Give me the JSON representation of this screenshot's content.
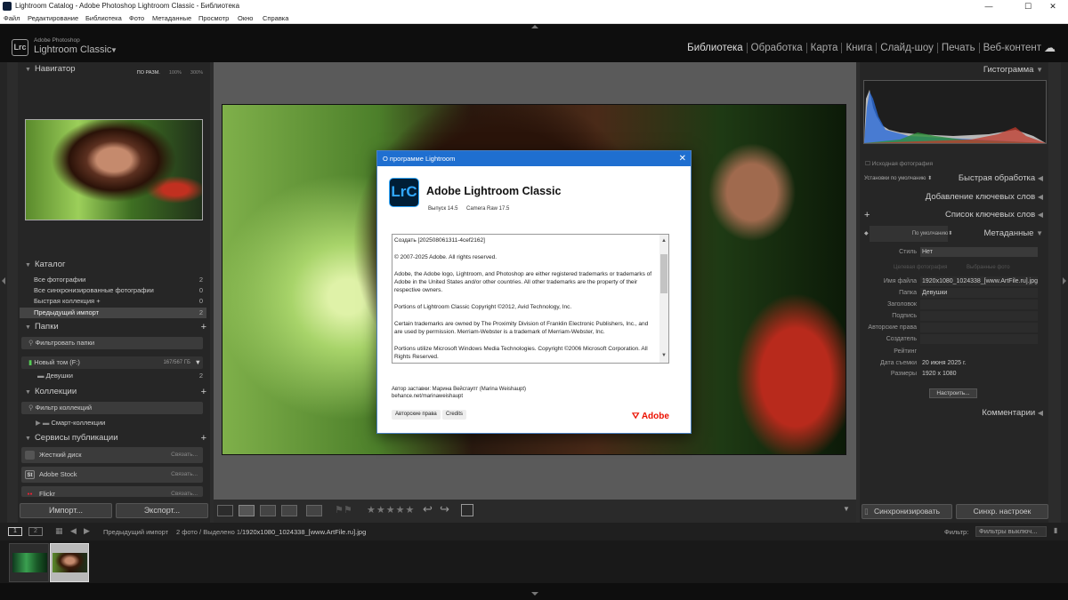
{
  "window": {
    "title": "Lightroom Catalog - Adobe Photoshop Lightroom Classic - Библиотека",
    "minimize": "—",
    "maximize": "☐",
    "close": "✕"
  },
  "menu": [
    "Файл",
    "Редактирование",
    "Библиотека",
    "Фото",
    "Метаданные",
    "Просмотр",
    "Окно",
    "Справка"
  ],
  "identity": {
    "logo": "Lrc",
    "sub": "Adobe Photoshop",
    "main": "Lightroom Classic",
    "arrow": "▼"
  },
  "modules": [
    "Библиотека",
    "Обработка",
    "Карта",
    "Книга",
    "Слайд-шоу",
    "Печать",
    "Веб-контент"
  ],
  "navigator": {
    "title": "Навигатор",
    "zoom": [
      "ПО РАЗМ.",
      "100%",
      "300%"
    ]
  },
  "catalog": {
    "title": "Каталог",
    "items": [
      {
        "label": "Все фотографии",
        "count": "2"
      },
      {
        "label": "Все синхронизированные фотографии",
        "count": "0"
      },
      {
        "label": "Быстрая коллекция  +",
        "count": "0"
      },
      {
        "label": "Предыдущий импорт",
        "count": "2"
      }
    ]
  },
  "folders": {
    "title": "Папки",
    "filter": "Фильтровать папки",
    "volume": "Новый том (F:)",
    "volume_space": "167/567 ГБ",
    "folder": "Девушки",
    "folder_count": "2"
  },
  "collections": {
    "title": "Коллекции",
    "filter": "Фильтр коллекций",
    "smart": "Смарт-коллекции"
  },
  "publish": {
    "title": "Сервисы публикации",
    "services": [
      {
        "name": "Жесткий диск",
        "link": "Связать...",
        "icon": ""
      },
      {
        "name": "Adobe Stock",
        "link": "Связать...",
        "icon": "St"
      },
      {
        "name": "Flickr",
        "link": "Связать...",
        "icon": "●●"
      }
    ]
  },
  "import_btn": "Импорт...",
  "export_btn": "Экспорт...",
  "right": {
    "histogram": "Гистограмма",
    "original": "Исходная фотография",
    "quick_preset": "Установки по умолчанию",
    "quick_develop": "Быстрая обработка",
    "keywording": "Добавление ключевых слов",
    "keyword_list": "Список ключевых слов",
    "meta_preset": "По умолчанию",
    "metadata": "Метаданные",
    "style_label": "Стиль",
    "style_value": "Нет",
    "tab_selected": "Целевая фотография",
    "tab_chosen": "Выбранные фото",
    "fields": [
      {
        "k": "Имя файла",
        "v": "1920x1080_1024338_[www.ArtFile.ru].jpg"
      },
      {
        "k": "Папка",
        "v": "Девушки"
      },
      {
        "k": "Заголовок",
        "v": ""
      },
      {
        "k": "Подпись",
        "v": ""
      },
      {
        "k": "Авторские права",
        "v": ""
      },
      {
        "k": "Создатель",
        "v": ""
      },
      {
        "k": "Рейтинг",
        "v": ""
      },
      {
        "k": "Дата съемки",
        "v": "20 июня 2025 г."
      },
      {
        "k": "Размеры",
        "v": "1920 x 1080"
      }
    ],
    "customize": "Настроить...",
    "comments": "Комментарии",
    "sync": "Синхронизировать",
    "sync_settings": "Синхр. настроек"
  },
  "filmbar": {
    "p1": "1",
    "p2": "2",
    "source": "Предыдущий импорт",
    "info": "2 фото / Выделено 1/",
    "file": "1920x1080_1024338_[www.ArtFile.ru].jpg",
    "filter_label": "Фильтр:",
    "filter_value": "Фильтры выключ..."
  },
  "dialog": {
    "title": "О программе Lightroom",
    "logo": "LrC",
    "product": "Adobe Lightroom Classic",
    "version": "Выпуск 14.5",
    "camera_raw": "Camera Raw 17.5",
    "license": [
      "Создать [202508061311-4cef2162]",
      "© 2007-2025 Adobe. All rights reserved.",
      "Adobe, the Adobe logo, Lightroom, and Photoshop are either registered trademarks or trademarks of Adobe in the United States and/or other countries. All other trademarks are the property of their respective owners.",
      "Portions of Lightroom Classic Copyright ©2012, Avid Technology, Inc.",
      "Certain trademarks are owned by The Proximity Division of Franklin Electronic Publishers, Inc., and are used by permission. Merriam-Webster is a trademark of Merriam-Webster, Inc.",
      "Portions utilize Microsoft Windows Media Technologies. Copyright ©2006 Microsoft Corporation. All Rights Reserved."
    ],
    "author": "Автор заставки: Марина Вейсгаупт (Marina Weishaupt)",
    "author_link": "behance.net/marinaweishaupt",
    "btn_rights": "Авторские права",
    "btn_credits": "Credits",
    "adobe": "Adobe"
  }
}
